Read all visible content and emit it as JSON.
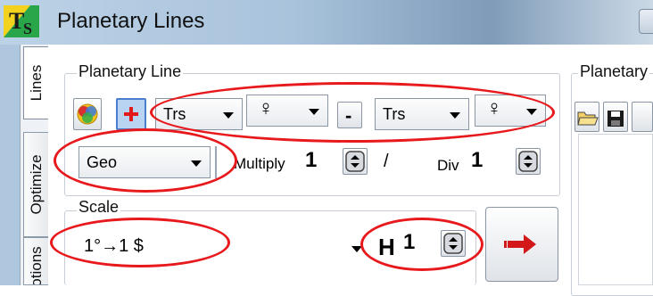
{
  "window": {
    "title": "Planetary Lines",
    "app_icon": "ts-logo-icon"
  },
  "tabs": [
    {
      "label": "Lines",
      "active": true
    },
    {
      "label": "Optimize",
      "active": false
    },
    {
      "label": "Options",
      "visible_text": "otions",
      "active": false
    }
  ],
  "planetary_line": {
    "label": "Planetary Line",
    "left": {
      "mode": "Trs",
      "planet_symbol": "♀"
    },
    "minus_label": "-",
    "right": {
      "mode": "Trs",
      "planet_symbol": "♀"
    },
    "coordinate": "Geo",
    "multiply": {
      "label": "Multiply",
      "value": "1"
    },
    "slash": "/",
    "div": {
      "label": "Div",
      "value": "1"
    }
  },
  "scale": {
    "label": "Scale",
    "value": "1°→1 $",
    "h_label": "H",
    "h_value": "1"
  },
  "right_panel": {
    "label": "Planetary"
  },
  "annotations": {
    "color": "#e8191c",
    "count": 5
  },
  "colors": {
    "accent_blue": "#4a7fd0",
    "titlebar": "#a9c3dc"
  }
}
